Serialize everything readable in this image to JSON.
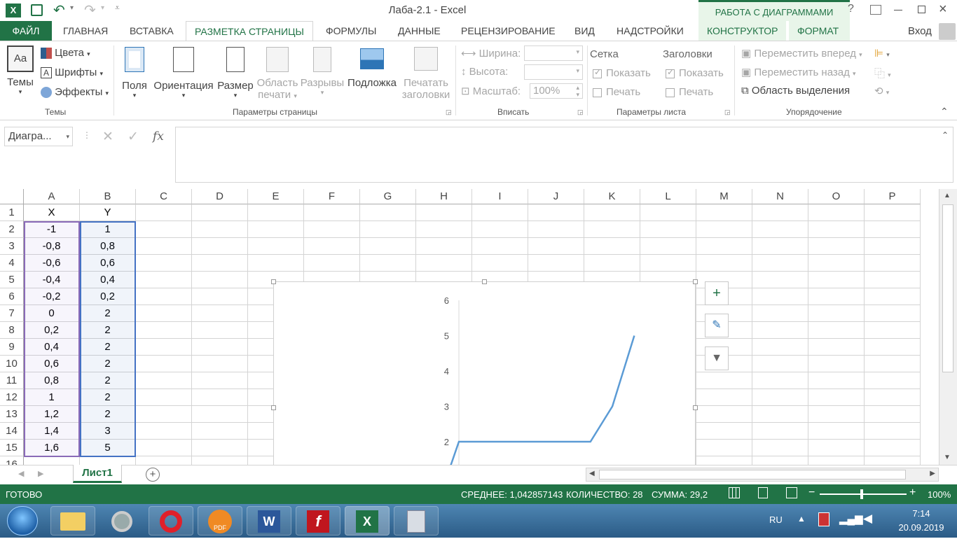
{
  "title": "Лаба-2.1 - Excel",
  "context_tab_header": "РАБОТА С ДИАГРАММАМИ",
  "login": "Вход",
  "help": "?",
  "tabs": [
    "ФАЙЛ",
    "ГЛАВНАЯ",
    "ВСТАВКА",
    "РАЗМЕТКА СТРАНИЦЫ",
    "ФОРМУЛЫ",
    "ДАННЫЕ",
    "РЕЦЕНЗИРОВАНИЕ",
    "ВИД",
    "НАДСТРОЙКИ",
    "КОНСТРУКТОР",
    "ФОРМАТ"
  ],
  "ribbon": {
    "themes": {
      "label": "Темы",
      "colors": "Цвета",
      "fonts": "Шрифты",
      "effects": "Эффекты",
      "group": "Темы"
    },
    "page_setup": {
      "margins": "Поля",
      "orientation": "Ориентация",
      "size": "Размер",
      "print_area_1": "Область",
      "print_area_2": "печати",
      "breaks": "Разрывы",
      "background": "Подложка",
      "print_titles_1": "Печатать",
      "print_titles_2": "заголовки",
      "group": "Параметры страницы"
    },
    "fit": {
      "width": "Ширина:",
      "height": "Высота:",
      "scale": "Масштаб:",
      "scale_value": "100%",
      "group": "Вписать"
    },
    "sheet_options": {
      "gridlines": "Сетка",
      "headings": "Заголовки",
      "show": "Показать",
      "print": "Печать",
      "group": "Параметры листа"
    },
    "arrange": {
      "forward": "Переместить вперед",
      "backward": "Переместить назад",
      "selection": "Область выделения",
      "group": "Упорядочение"
    }
  },
  "name_box": "Диагра...",
  "fx": "fx",
  "columns": [
    "A",
    "B",
    "C",
    "D",
    "E",
    "F",
    "G",
    "H",
    "I",
    "J",
    "K",
    "L",
    "M",
    "N",
    "O",
    "P"
  ],
  "rows": [
    "1",
    "2",
    "3",
    "4",
    "5",
    "6",
    "7",
    "8",
    "9",
    "10",
    "11",
    "12",
    "13",
    "14",
    "15",
    "16"
  ],
  "table": [
    [
      "X",
      "Y"
    ],
    [
      "-1",
      "1"
    ],
    [
      "-0,8",
      "0,8"
    ],
    [
      "-0,6",
      "0,6"
    ],
    [
      "-0,4",
      "0,4"
    ],
    [
      "-0,2",
      "0,2"
    ],
    [
      "0",
      "2"
    ],
    [
      "0,2",
      "2"
    ],
    [
      "0,4",
      "2"
    ],
    [
      "0,6",
      "2"
    ],
    [
      "0,8",
      "2"
    ],
    [
      "1",
      "2"
    ],
    [
      "1,2",
      "2"
    ],
    [
      "1,4",
      "3"
    ],
    [
      "1,6",
      "5"
    ]
  ],
  "sheet_tab": "Лист1",
  "status": {
    "ready": "ГОТОВО",
    "avg": "СРЕДНЕЕ: 1,042857143",
    "count": "КОЛИЧЕСТВО: 28",
    "sum": "СУММА: 29,2",
    "zoom": "100%"
  },
  "taskbar": {
    "lang": "RU",
    "time": "7:14",
    "date": "20.09.2019"
  },
  "colors": {
    "excel_green": "#217346",
    "series": "#5b9bd5"
  },
  "chart_data": {
    "type": "line",
    "y_ticks": [
      "6",
      "5",
      "4",
      "3",
      "2"
    ],
    "ylim": [
      0,
      6
    ],
    "x": [
      -1,
      -0.8,
      -0.6,
      -0.4,
      -0.2,
      0,
      0.2,
      0.4,
      0.6,
      0.8,
      1,
      1.2,
      1.4,
      1.6
    ],
    "series": [
      {
        "values": [
          1,
          0.8,
          0.6,
          0.4,
          0.2,
          2,
          2,
          2,
          2,
          2,
          2,
          2,
          3,
          5
        ]
      }
    ]
  }
}
